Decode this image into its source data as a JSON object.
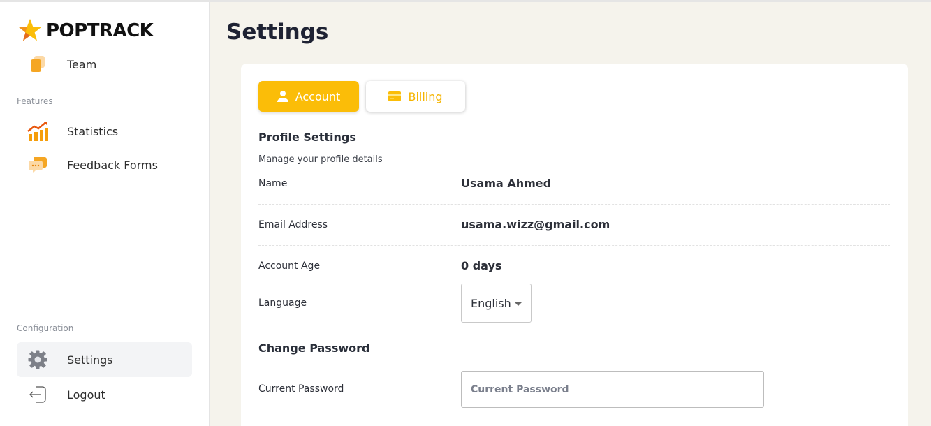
{
  "app": {
    "logo_text": "POPTRACK"
  },
  "sidebar": {
    "items_top": [
      {
        "label": "Team",
        "icon": "team-icon"
      }
    ],
    "features_label": "Features",
    "features": [
      {
        "label": "Statistics",
        "icon": "statistics-icon"
      },
      {
        "label": "Feedback Forms",
        "icon": "feedback-icon"
      }
    ],
    "configuration_label": "Configuration",
    "configuration": [
      {
        "label": "Settings",
        "icon": "gear-icon",
        "active": true
      },
      {
        "label": "Logout",
        "icon": "logout-icon"
      }
    ]
  },
  "main": {
    "title": "Settings",
    "tabs": [
      {
        "label": "Account",
        "icon": "user-icon",
        "selected": true
      },
      {
        "label": "Billing",
        "icon": "card-icon",
        "selected": false
      }
    ],
    "profile": {
      "title": "Profile Settings",
      "subtitle": "Manage your profile details",
      "rows": [
        {
          "label": "Name",
          "value": "Usama Ahmed"
        },
        {
          "label": "Email Address",
          "value": "usama.wizz@gmail.com"
        },
        {
          "label": "Account Age",
          "value": "0 days"
        }
      ],
      "language_label": "Language",
      "language_value": "English"
    },
    "password": {
      "title": "Change Password",
      "current_label": "Current Password",
      "current_placeholder": "Current Password",
      "current_value": ""
    }
  },
  "colors": {
    "accent": "#fbbd08",
    "background": "#f5f3ec",
    "sidebar": "#ffffff"
  }
}
